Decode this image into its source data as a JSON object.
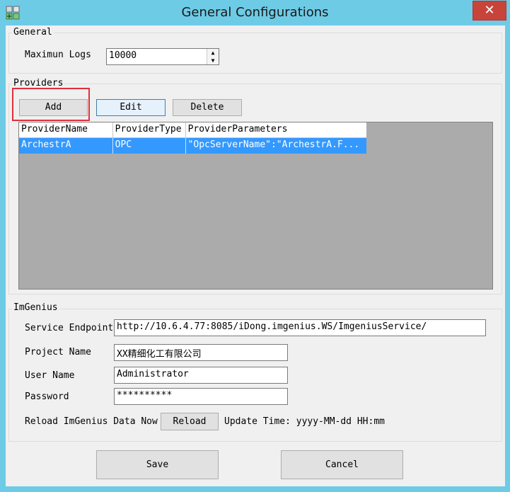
{
  "window": {
    "title": "General Configurations",
    "close_glyph": "✕"
  },
  "general": {
    "group_label": "General",
    "max_logs_label": "Maximun Logs",
    "max_logs_value": "10000"
  },
  "providers": {
    "group_label": "Providers",
    "add_label": "Add",
    "edit_label": "Edit",
    "delete_label": "Delete",
    "columns": [
      "ProviderName",
      "ProviderType",
      "ProviderParameters"
    ],
    "rows": [
      {
        "name": "ArchestrA",
        "type": "OPC",
        "params": "\"OpcServerName\":\"ArchestrA.F..."
      }
    ]
  },
  "imgenius": {
    "group_label": "ImGenius",
    "endpoint_label": "Service Endpoint",
    "endpoint_value": "http://10.6.4.77:8085/iDong.imgenius.WS/ImgeniusService/",
    "project_label": "Project Name",
    "project_value": "XX精细化工有限公司",
    "user_label": "User Name",
    "user_value": "Administrator",
    "password_label": "Password",
    "password_value": "**********",
    "reload_label": "Reload ImGenius Data Now",
    "reload_button": "Reload",
    "update_time": "Update Time: yyyy-MM-dd HH:mm"
  },
  "footer": {
    "save_label": "Save",
    "cancel_label": "Cancel"
  },
  "colors": {
    "titlebar": "#6ecbe6",
    "close": "#c8443a",
    "selection": "#3399ff",
    "highlight_box": "#e0303a"
  }
}
